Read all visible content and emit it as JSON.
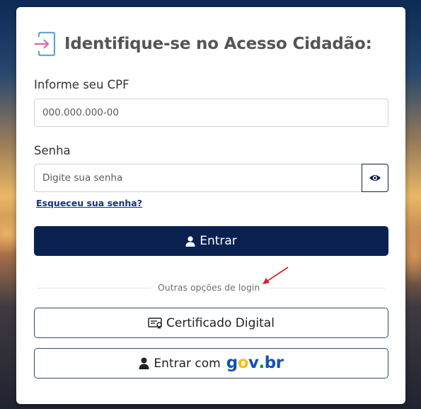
{
  "login": {
    "title": "Identifique-se no Acesso Cidadão:",
    "cpf": {
      "label": "Informe seu CPF",
      "placeholder": "000.000.000-00"
    },
    "password": {
      "label": "Senha",
      "placeholder": "Digite sua senha",
      "forgot_link": "Esqueceu sua senha?"
    },
    "submit_label": "Entrar",
    "divider_text": "Outras opções de login",
    "certificate_label": "Certificado Digital",
    "govbr": {
      "prefix_label": "Entrar com",
      "logo_g": "g",
      "logo_o": "o",
      "logo_v": "v",
      "logo_dot": ".",
      "logo_b": "b",
      "logo_r": "r"
    }
  },
  "icons": {
    "title_icon": "login-arrow-icon",
    "eye_icon": "eye-icon",
    "submit_icon": "user-icon",
    "certificate_icon": "certificate-icon",
    "govbr_icon": "user-icon"
  },
  "colors": {
    "primary": "#0a2150",
    "link": "#133475",
    "annotation_arrow": "#d9202a",
    "govbr_blue": "#1351b4",
    "govbr_yellow": "#fcbe11",
    "govbr_green": "#168821"
  }
}
